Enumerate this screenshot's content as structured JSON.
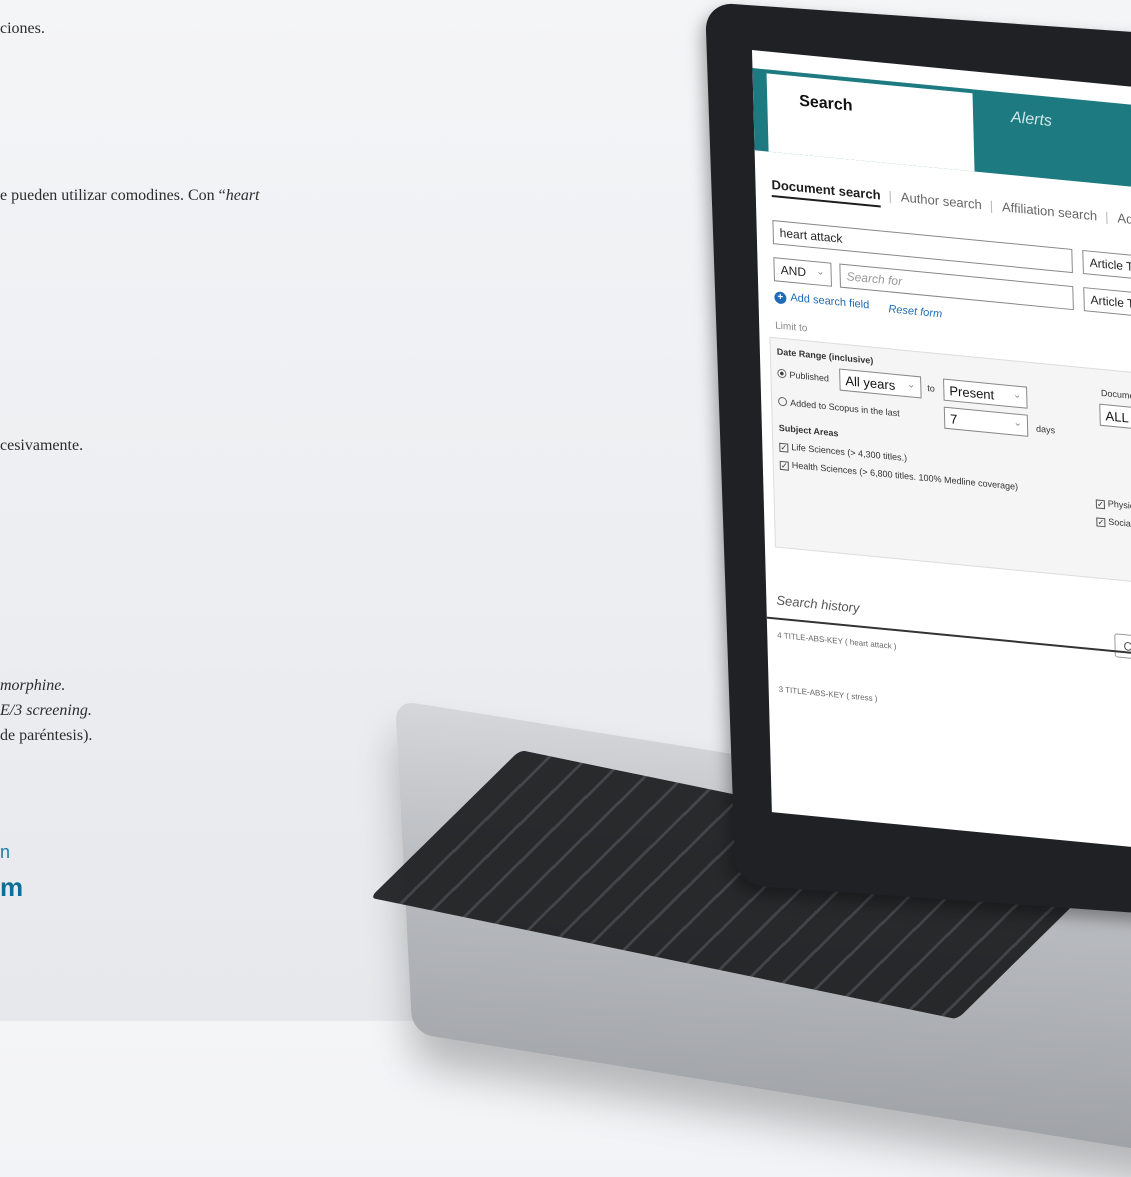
{
  "background_doc": {
    "line1": "ciones.",
    "line2_prefix": "e pueden utilizar comodines.  Con “",
    "line2_italic": "heart",
    "line3": "cesivamente.",
    "line4_italic": "morphine.",
    "line5_italic": "E/3 screening.",
    "line6": "de paréntesis).",
    "blue1": "n",
    "blue2": "m"
  },
  "screen": {
    "tabs": {
      "search": "Search",
      "alerts": "Alerts"
    },
    "subtabs": [
      "Document search",
      "Author search",
      "Affiliation search",
      "Ad"
    ],
    "query1": {
      "value": "heart attack",
      "field": "Article Ti"
    },
    "query2": {
      "operator": "AND",
      "placeholder": "Search for",
      "field": "Article Tit"
    },
    "add_field": "Add search field",
    "reset_form": "Reset form",
    "limit_to": "Limit to",
    "date_range_label": "Date Range (inclusive)",
    "published_label": "Published",
    "from_year": "All years",
    "to_label": "to",
    "to_year": "Present",
    "added_label": "Added to Scopus in the last",
    "days_value": "7",
    "days_label": "days",
    "document_type_label": "Documen",
    "document_type_value": "ALL",
    "subject_areas_label": "Subject Areas",
    "subjects_left": [
      "Life Sciences (> 4,300 titles.)",
      "Health Sciences (> 6,800 titles. 100% Medline coverage)"
    ],
    "subjects_right": [
      "Physica",
      "Social S"
    ],
    "search_history_label": "Search history",
    "combine_label": "Combin",
    "history": [
      {
        "num": "4",
        "query": "TITLE-ABS-KEY ( heart attack )"
      },
      {
        "num": "3",
        "query": "TITLE-ABS-KEY ( stress )"
      }
    ]
  },
  "colors": {
    "tab_bar": "#1d7a80",
    "link": "#1e6bb8",
    "doc_blue": "#1a7fa6"
  }
}
